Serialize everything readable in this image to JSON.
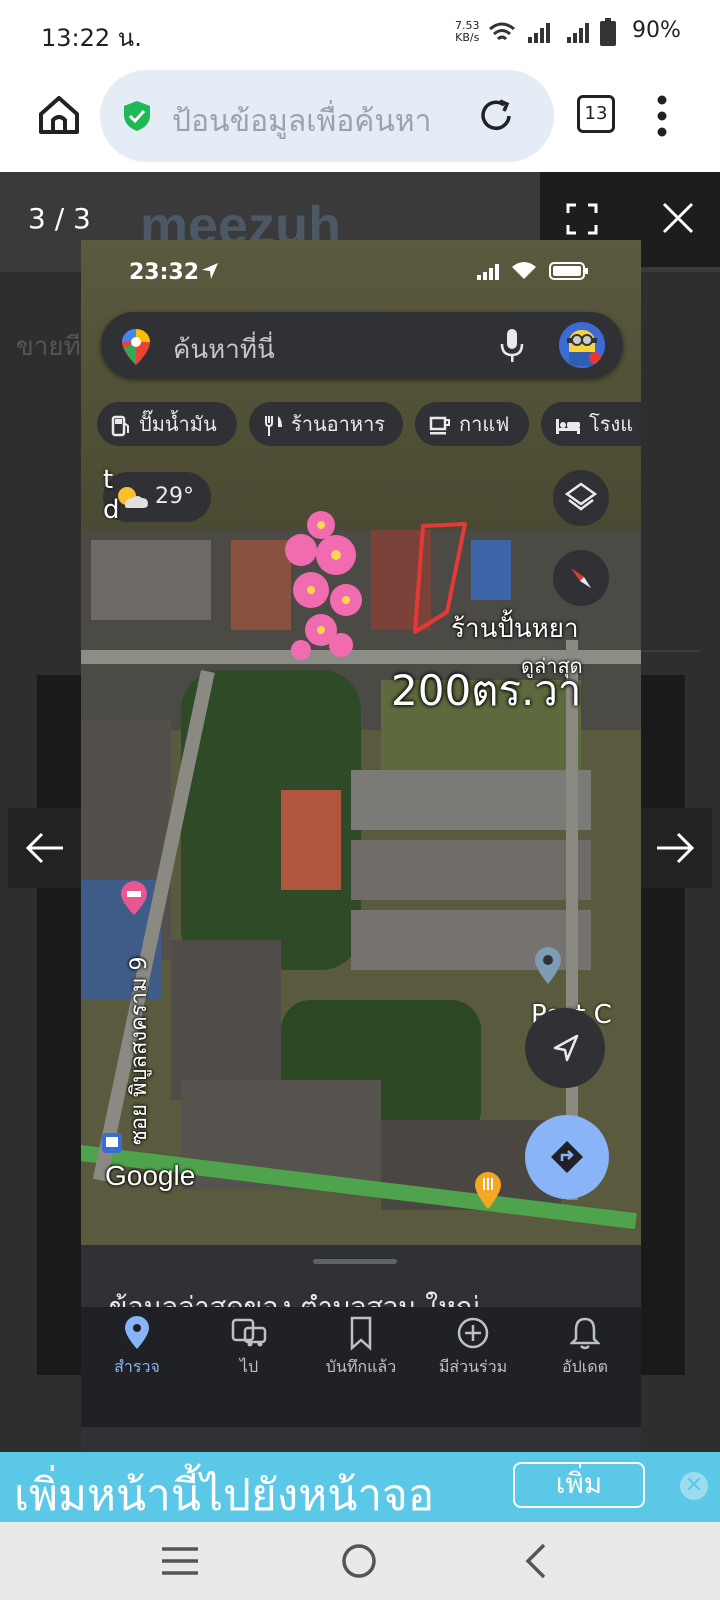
{
  "status_bar": {
    "time": "13:22 น.",
    "net_speed_value": "7.53",
    "net_speed_unit": "KB/s",
    "battery": "90%"
  },
  "browser": {
    "placeholder": "ป้อนข้อมูลเพื่อค้นหา",
    "tab_count": "13"
  },
  "site": {
    "logo": "meezuh",
    "text_fragment": "ขายที"
  },
  "lightbox": {
    "counter": "3 / 3"
  },
  "phone": {
    "time": "23:32",
    "search_placeholder": "ค้นหาที่นี่",
    "chips": [
      {
        "label": "ปั๊มน้ำมัน",
        "icon": "gas-station-icon"
      },
      {
        "label": "ร้านอาหาร",
        "icon": "restaurant-icon"
      },
      {
        "label": "กาแฟ",
        "icon": "coffee-icon"
      },
      {
        "label": "โรงแ",
        "icon": "hotel-icon"
      }
    ],
    "weather": "29°",
    "map_labels": {
      "shop": "ร้านปั้นหยา",
      "latest": "ดูล่าสุด",
      "area": "200ตร.วา",
      "soi": "ซอย พิบูลสงคราม 9",
      "google": "Google",
      "left_fragment": "t\nd",
      "post_fragment": "Post C"
    },
    "sheet_title": "ข้อมูลล่าสุดของ ตำบลสวน ใหญ่",
    "nav": [
      {
        "label": "สำรวจ",
        "icon": "explore-pin-icon",
        "active": true
      },
      {
        "label": "ไป",
        "icon": "commute-icon",
        "active": false
      },
      {
        "label": "บันทึกแล้ว",
        "icon": "bookmark-icon",
        "active": false
      },
      {
        "label": "มีส่วนร่วม",
        "icon": "add-circle-icon",
        "active": false
      },
      {
        "label": "อัปเดต",
        "icon": "bell-icon",
        "active": false
      }
    ],
    "active_color": "#8ab4f8"
  },
  "banner": {
    "text": "เพิ่มหน้านี้ไปยังหน้าจอ",
    "button": "เพิ่ม"
  },
  "colors": {
    "banner": "#5bc8e8",
    "plot_outline": "#e53935",
    "shield": "#1db954"
  }
}
